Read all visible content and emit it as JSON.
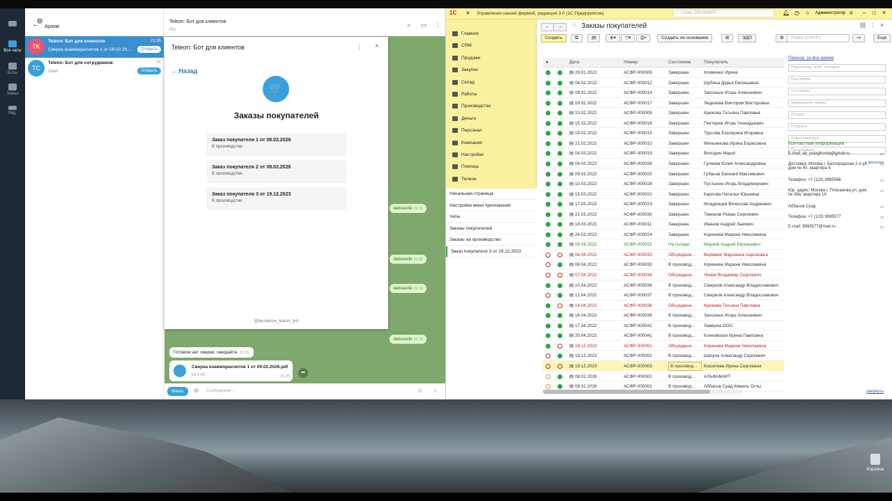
{
  "telegram": {
    "nav": [
      {
        "label": "Все чаты",
        "badge": "2"
      },
      {
        "label": "Боты"
      },
      {
        "label": "Teleon"
      },
      {
        "label": "Ред."
      }
    ],
    "list_header": "Архив",
    "archive_badge": "2",
    "chats": [
      {
        "avatar": "TK",
        "avatar_color": "#e2566f",
        "title": "Teleon: Бот для клиентов",
        "sub": "Сверка взаиморасчетов 1 от 09.02.20...",
        "time": "21:35",
        "button": "Открыть"
      },
      {
        "avatar": "TC",
        "avatar_color": "#3aa0dd",
        "title": "Teleon: Бот для сотрудников",
        "sub": "/start",
        "time": "Чт",
        "button": "Открыть"
      }
    ],
    "chat_title": "Teleon: Бот для клиентов",
    "chat_subtitle": "бот",
    "mini_app": {
      "title": "Teleon: Бот для клиентов",
      "back": "← Назад",
      "heading": "Заказы покупателей",
      "orders": [
        {
          "title": "Заказ покупателя 1 от 08.02.2026",
          "status": "В производстве"
        },
        {
          "title": "Заказ покупателя 2 от 08.02.2026",
          "status": "В производстве"
        },
        {
          "title": "Заказ покупателя 3 от 19.12.2023",
          "status": "В производстве"
        }
      ],
      "footer": "@beshenov_teleon_bot"
    },
    "messages": [
      {
        "text": "/aktsverki",
        "time": "21:31"
      },
      {
        "text": "/aktsverki",
        "time": "21:32"
      },
      {
        "text": "/aktsverki",
        "time": "21:33"
      },
      {
        "text": "/aktsverki",
        "time": "21:34"
      }
    ],
    "reply": {
      "text": "Готовлю акт сверки, ожидайте.",
      "time": "21:35"
    },
    "file": {
      "name": "Сверка взаиморасчетов 1 от 09.02.2026.pdf",
      "size": "69.4 KB",
      "time": "21:35"
    },
    "input": {
      "menu": "Меню",
      "placeholder": "Сообщение..."
    }
  },
  "onec": {
    "app_title": "Управление нашей фирмой, редакция 3.0  (1С:Предприятие)",
    "search_placeholder": "Поиск Ctrl+Shift+F",
    "user": "Администратор",
    "menu": [
      "Главное",
      "CRM",
      "Продажи",
      "Закупки",
      "Склад",
      "Работы",
      "Производство",
      "Деньги",
      "Персонал",
      "Компания",
      "Настройки",
      "Помощь",
      "Телеон"
    ],
    "open_windows": [
      "Начальная страница",
      "Настройки мини приложения",
      "Чаты",
      "Заказы покупателей",
      "Заказы на производство",
      "Заказ покупателя 3 от 19.12.2023"
    ],
    "form_title": "Заказы покупателей",
    "toolbar": {
      "create": "Создать",
      "create_based": "Создать на основании",
      "edo": "ЭДО",
      "search_placeholder": "Поиск (Ctrl+F)",
      "more": "Еще"
    },
    "columns": [
      "Дата",
      "Номер",
      "Состояние",
      "Покупатель"
    ],
    "rows": [
      {
        "date": "28.01.2022",
        "num": "АСФР-000005",
        "state": "Завершен",
        "buyer": "Клименко Ирина",
        "c1": "#2aa84a",
        "c2": "#2aa84a",
        "color": "#333"
      },
      {
        "date": "04.02.2022",
        "num": "АСФР-000012",
        "state": "Завершен",
        "buyer": "Шубина Дарья Евгеньевна",
        "c1": "#2aa84a",
        "c2": "#2aa84a",
        "color": "#333"
      },
      {
        "date": "08.02.2022",
        "num": "АСФР-000014",
        "state": "Завершен",
        "buyer": "Запозных Игорь Алексеевич",
        "c1": "#2aa84a",
        "c2": "#2aa84a",
        "color": "#333"
      },
      {
        "date": "09.02.2022",
        "num": "АСФР-000017",
        "state": "Завершен",
        "buyer": "Леденева Виктория Викторовна",
        "c1": "#2aa84a",
        "c2": "#2aa84a",
        "color": "#333"
      },
      {
        "date": "10.02.2022",
        "num": "АСФР-000009",
        "state": "Завершен",
        "buyer": "Крюкова Татьяна Павловна",
        "c1": "#2aa84a",
        "c2": "#2aa84a",
        "color": "#333"
      },
      {
        "date": "15.02.2022",
        "num": "АСФР-000018",
        "state": "Завершен",
        "buyer": "Пехтерев Игорь Геннадьевич",
        "c1": "#2aa84a",
        "c2": "#2aa84a",
        "color": "#333"
      },
      {
        "date": "19.02.2022",
        "num": "АСФР-000015",
        "state": "Завершен",
        "buyer": "Трусова Екатерина Игоревна",
        "c1": "#2aa84a",
        "c2": "#2aa84a",
        "color": "#333"
      },
      {
        "date": "22.02.2022",
        "num": "АСФР-000010",
        "state": "Завершен",
        "buyer": "Мельникова Ирина Борисовна",
        "c1": "#2aa84a",
        "c2": "#2aa84a",
        "color": "#333"
      },
      {
        "date": "04.03.2022",
        "num": "АСФР-000019",
        "state": "Завершен",
        "buyer": "Володин Марат",
        "c1": "#2aa84a",
        "c2": "#2aa84a",
        "color": "#333"
      },
      {
        "date": "04.03.2022",
        "num": "АСФР-000026",
        "state": "Завершен",
        "buyer": "Гуляева Юлия Александровна",
        "c1": "#2aa84a",
        "c2": "#2aa84a",
        "color": "#333"
      },
      {
        "date": "09.03.2022",
        "num": "АСФР-000025",
        "state": "Завершен",
        "buyer": "Губанов Евгений Максимович",
        "c1": "#2aa84a",
        "c2": "#2aa84a",
        "color": "#333"
      },
      {
        "date": "10.03.2022",
        "num": "АСФР-000028",
        "state": "Завершен",
        "buyer": "Пустынин Игорь Владимирович",
        "c1": "#2aa84a",
        "c2": "#2aa84a",
        "color": "#333"
      },
      {
        "date": "15.03.2022",
        "num": "АСФР-000021",
        "state": "Завершен",
        "buyer": "Карпова Наталья Юрьевна",
        "c1": "#2aa84a",
        "c2": "#2aa84a",
        "color": "#333"
      },
      {
        "date": "17.03.2022",
        "num": "АСФР-000023",
        "state": "Завершен",
        "buyer": "Младенцев Вячеслав Андреевич",
        "c1": "#2aa84a",
        "c2": "#2aa84a",
        "color": "#333"
      },
      {
        "date": "22.03.2022",
        "num": "АСФР-000030",
        "state": "Завершен",
        "buyer": "Тимонов Роман Сергеевич",
        "c1": "#2aa84a",
        "c2": "#2aa84a",
        "color": "#333"
      },
      {
        "date": "18.03.2022",
        "num": "АСФР-000011",
        "state": "Завершен",
        "buyer": "Иванов Андрей Львович",
        "c1": "#2aa84a",
        "c2": "#2aa84a",
        "color": "#333"
      },
      {
        "date": "24.03.2022",
        "num": "АСФР-000024",
        "state": "Завершен",
        "buyer": "Коренева Марина Николаевна",
        "c1": "#2aa84a",
        "c2": "#2aa84a",
        "color": "#333"
      },
      {
        "date": "06.04.2022",
        "num": "АСФР-000032",
        "state": "На складе",
        "buyer": "Марков Андрей Евгеньевич",
        "c1": "#2aa84a",
        "c2": "#2aa84a",
        "color": "#2a8a2a"
      },
      {
        "date": "06.04.2022",
        "num": "АСФР-000033",
        "state": "Обсуждени...",
        "buyer": "Верквинг Марианна Аароновна",
        "c1": "#b22",
        "c2": "#b22",
        "color": "#b22"
      },
      {
        "date": "06.04.2022",
        "num": "АСФР-000035",
        "state": "В производ...",
        "buyer": "Коренева Марина Николаевна",
        "c1": "#b22",
        "c2": "#2aa84a",
        "color": "#333"
      },
      {
        "date": "07.04.2022",
        "num": "АСФР-000034",
        "state": "Обсуждени...",
        "buyer": "Линев Владимир Сергеевич",
        "c1": "#b22",
        "c2": "#b22",
        "color": "#b22"
      },
      {
        "date": "10.04.2022",
        "num": "АСФР-000036",
        "state": "В производ...",
        "buyer": "Смирнов Александр Владиславович",
        "c1": "#2aa84a",
        "c2": "#2aa84a",
        "color": "#333"
      },
      {
        "date": "12.04.2022",
        "num": "АСФР-000037",
        "state": "В производ...",
        "buyer": "Смирнов Александр Владиславович",
        "c1": "#b22",
        "c2": "#2aa84a",
        "color": "#333"
      },
      {
        "date": "14.04.2022",
        "num": "АСФР-000038",
        "state": "Обсуждени...",
        "buyer": "Крюкова Татьяна Павловна",
        "c1": "#2aa84a",
        "c2": "#b22",
        "color": "#b22"
      },
      {
        "date": "16.04.2022",
        "num": "АСФР-000039",
        "state": "В производ...",
        "buyer": "Запозных Игорь Алексеевич",
        "c1": "#2aa84a",
        "c2": "#2aa84a",
        "color": "#333"
      },
      {
        "date": "17.04.2022",
        "num": "АСФР-000042",
        "state": "В производ...",
        "buyer": "Лаверна ООО",
        "c1": "#2aa84a",
        "c2": "#2aa84a",
        "color": "#333"
      },
      {
        "date": "20.04.2022",
        "num": "АСФР-000041",
        "state": "В производ...",
        "buyer": "Кленовская Ирина Павловна",
        "c1": "#2aa84a",
        "c2": "#2aa84a",
        "color": "#333"
      },
      {
        "date": "18.12.2023",
        "num": "АСФР-000001",
        "state": "Обсуждени...",
        "buyer": "Коренева Марина Николаевна",
        "c1": "#2aa84a",
        "c2": "#b22",
        "color": "#b22"
      },
      {
        "date": "18.12.2023",
        "num": "АСФР-000002",
        "state": "В производ...",
        "buyer": "Шапуха Александр Сергеевич",
        "c1": "#b22",
        "c2": "#2aa84a",
        "color": "#333"
      },
      {
        "date": "19.12.2023",
        "num": "АСФР-000003",
        "state": "В производ...",
        "buyer": "Кошелева Ирина Сергеевна",
        "c1": "#b22",
        "c2": "#b22",
        "color": "#333",
        "selected": true
      },
      {
        "date": "08.02.2026",
        "num": "АСФР-000001",
        "state": "В производ...",
        "buyer": "АЛЬФАМАРТ",
        "c1": "#cc9a2a",
        "c2": "#2aa84a",
        "color": "#333"
      },
      {
        "date": "08.02.2026",
        "num": "АСФР-000002",
        "state": "В производ...",
        "buyer": "Аббасов Суад Кямиль Оглы",
        "c1": "#cc9a2a",
        "c2": "#2aa84a",
        "color": "#333"
      }
    ],
    "period": "Период: за все время",
    "filters": [
      "Покупатель, ИНН, телефон",
      "Вид заказа",
      "Состояние",
      "Завершение заказа",
      "Оплата",
      "Отгрузка",
      "Ответственный",
      "Организация"
    ],
    "more_filters": "+ фильтры",
    "contact_title": "Контактная информация",
    "contacts": [
      "E-mail: ab_uslugihome@gmail.ru",
      "Доставка: Москва г, Белгородская 2-я ул, дом № 60, квартира 8",
      "Телефон: +7 (123) 9995566",
      "Юр. адрес: Москва г, Плеханова ул, дом № 49а, квартира 19",
      "Аббасов Суад",
      "Телефон: +7 (123) 9995577",
      "E-mail: 9995577@mail.ru"
    ],
    "collapse": "свернуть"
  },
  "desktop": {
    "recycle": "Корзина"
  }
}
